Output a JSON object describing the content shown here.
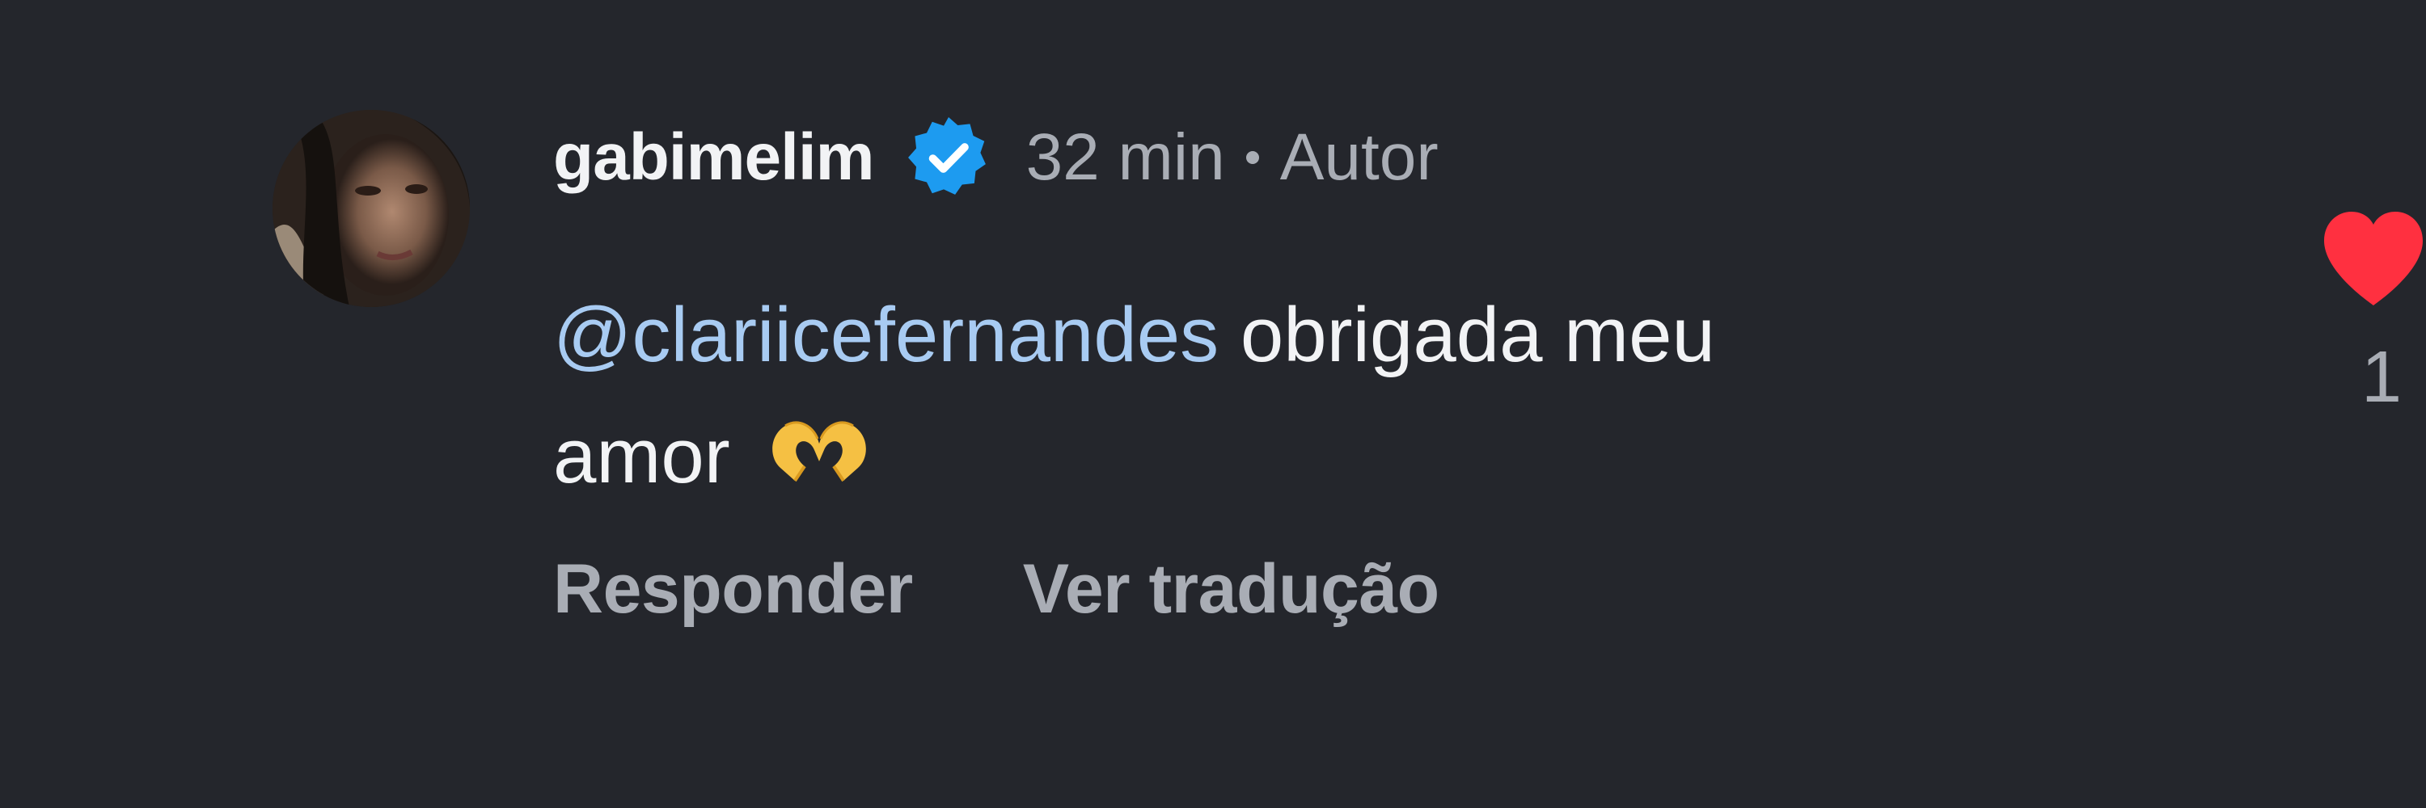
{
  "comment": {
    "username": "gabimelim",
    "verified_icon": "verified-badge-icon",
    "time": "32 min",
    "author_label": "Autor",
    "mention": "@clariicefernandes",
    "text_part1": " obrigada meu",
    "text_part2": "amor ",
    "emoji": "heart-hands",
    "actions": {
      "reply": "Responder",
      "translate": "Ver tradução"
    },
    "like": {
      "icon": "heart-icon",
      "count": "1",
      "color": "#ff3040"
    }
  },
  "colors": {
    "background": "#24262c",
    "text_primary": "#f2f3f5",
    "text_secondary": "#a9adb5",
    "mention": "#a8cbf2",
    "verified": "#1d9bf0"
  }
}
